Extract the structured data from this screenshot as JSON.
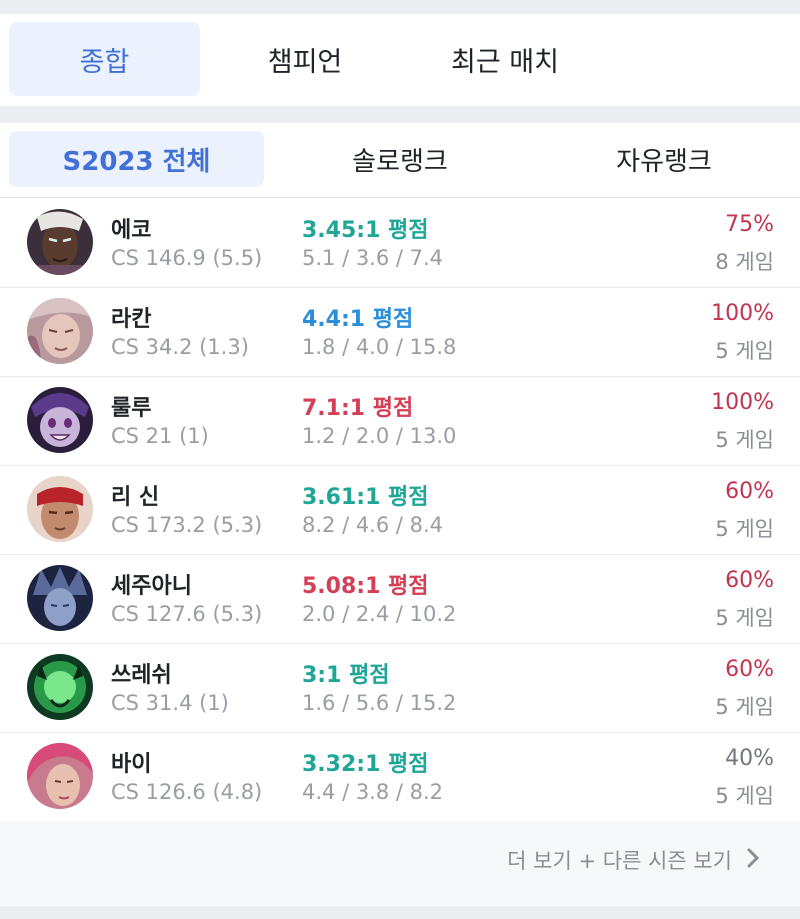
{
  "top_tabs": [
    {
      "label": "종합",
      "active": true
    },
    {
      "label": "챔피언",
      "active": false
    },
    {
      "label": "최근 매치",
      "active": false
    }
  ],
  "queue_tabs": [
    {
      "label": "S2023 전체",
      "active": true
    },
    {
      "label": "솔로랭크",
      "active": false
    },
    {
      "label": "자유랭크",
      "active": false
    }
  ],
  "colors": {
    "kda_teal": "#1fa697",
    "kda_blue": "#2a8fd8",
    "kda_red": "#d43f56",
    "winrate_red": "#c23452",
    "winrate_gray": "#73767d"
  },
  "champions": [
    {
      "name": "에코",
      "cs": "CS 146.9 (5.5)",
      "kda": "3.45:1 평점",
      "kda_tier": "teal",
      "kda_detail": "5.1 / 3.6 / 7.4",
      "winrate": "75%",
      "winrate_tier": "red",
      "games": "8 게임",
      "icon": "ekko-portrait"
    },
    {
      "name": "라칸",
      "cs": "CS 34.2 (1.3)",
      "kda": "4.4:1 평점",
      "kda_tier": "blue",
      "kda_detail": "1.8 / 4.0 / 15.8",
      "winrate": "100%",
      "winrate_tier": "red",
      "games": "5 게임",
      "icon": "rakan-portrait"
    },
    {
      "name": "룰루",
      "cs": "CS 21 (1)",
      "kda": "7.1:1 평점",
      "kda_tier": "red",
      "kda_detail": "1.2 / 2.0 / 13.0",
      "winrate": "100%",
      "winrate_tier": "red",
      "games": "5 게임",
      "icon": "lulu-portrait"
    },
    {
      "name": "리 신",
      "cs": "CS 173.2 (5.3)",
      "kda": "3.61:1 평점",
      "kda_tier": "teal",
      "kda_detail": "8.2 / 4.6 / 8.4",
      "winrate": "60%",
      "winrate_tier": "red",
      "games": "5 게임",
      "icon": "lee-sin-portrait"
    },
    {
      "name": "세주아니",
      "cs": "CS 127.6 (5.3)",
      "kda": "5.08:1 평점",
      "kda_tier": "red",
      "kda_detail": "2.0 / 2.4 / 10.2",
      "winrate": "60%",
      "winrate_tier": "red",
      "games": "5 게임",
      "icon": "sejuani-portrait"
    },
    {
      "name": "쓰레쉬",
      "cs": "CS 31.4 (1)",
      "kda": "3:1 평점",
      "kda_tier": "teal",
      "kda_detail": "1.6 / 5.6 / 15.2",
      "winrate": "60%",
      "winrate_tier": "red",
      "games": "5 게임",
      "icon": "thresh-portrait"
    },
    {
      "name": "바이",
      "cs": "CS 126.6 (4.8)",
      "kda": "3.32:1 평점",
      "kda_tier": "teal",
      "kda_detail": "4.4 / 3.8 / 8.2",
      "winrate": "40%",
      "winrate_tier": "gray",
      "games": "5 게임",
      "icon": "vi-portrait"
    }
  ],
  "more_link": {
    "label": "더 보기 + 다른 시즌 보기",
    "icon": "chevron-right-icon"
  }
}
